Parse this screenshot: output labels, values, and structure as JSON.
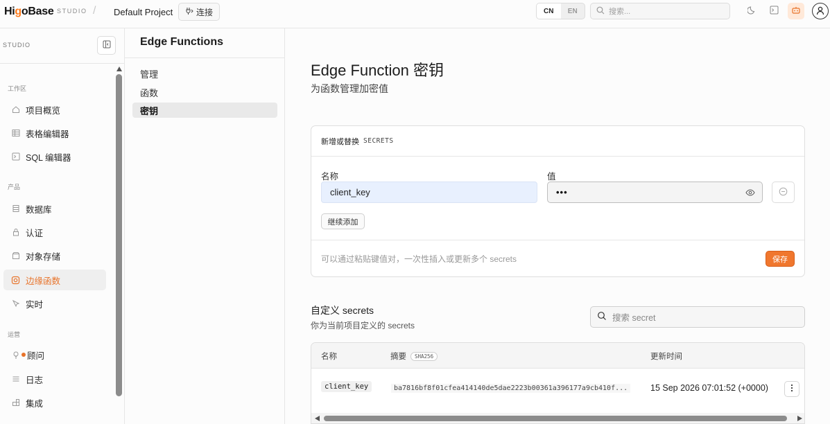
{
  "topbar": {
    "brand_prefix": "Hi",
    "brand_o": "g",
    "brand_suffix": "oBase",
    "studio_tag": "STUDIO",
    "separator": "/",
    "project_name": "Default Project",
    "connect_label": "连接",
    "lang_cn": "CN",
    "lang_en": "EN",
    "lang_active": "CN",
    "search_placeholder": "搜索...",
    "accent_color": "#f0772e"
  },
  "sidebar": {
    "header": "STUDIO",
    "sections": [
      {
        "label": "工作区"
      },
      {
        "label": "产品"
      },
      {
        "label": "运营"
      }
    ],
    "items": [
      {
        "label": "项目概览",
        "icon": "home-icon"
      },
      {
        "label": "表格编辑器",
        "icon": "table-icon"
      },
      {
        "label": "SQL 编辑器",
        "icon": "terminal-icon"
      },
      {
        "label": "数据库",
        "icon": "database-icon"
      },
      {
        "label": "认证",
        "icon": "lock-icon"
      },
      {
        "label": "对象存储",
        "icon": "archive-icon"
      },
      {
        "label": "边缘函数",
        "icon": "edge-function-icon",
        "active": true
      },
      {
        "label": "实时",
        "icon": "pointer-icon"
      },
      {
        "label": "顾问",
        "icon": "lightbulb-icon"
      },
      {
        "label": "日志",
        "icon": "list-icon"
      },
      {
        "label": "集成",
        "icon": "grid-icon"
      }
    ]
  },
  "subnav": {
    "title": "Edge Functions",
    "items": [
      {
        "label": "管理"
      },
      {
        "label": "函数"
      },
      {
        "label": "密钥",
        "active": true
      }
    ]
  },
  "main": {
    "title": "Edge Function 密钥",
    "subtitle": "为函数管理加密值",
    "card": {
      "header_label": "新增或替换",
      "header_mono": "SECRETS",
      "name_label": "名称",
      "value_label": "值",
      "name_value": "client_key",
      "value_masked": "•••",
      "add_more_label": "继续添加",
      "hint": "可以通过粘贴键值对，一次性插入或更新多个 secrets",
      "save_label": "保存"
    },
    "custom": {
      "title": "自定义 secrets",
      "subtitle": "你为当前项目定义的 secrets",
      "search_placeholder": "搜索 secret"
    },
    "table": {
      "columns": [
        "名称",
        "摘要",
        "更新时间"
      ],
      "digest_badge": "SHA256",
      "rows": [
        {
          "name": "client_key",
          "digest": "ba7816bf8f01cfea414140de5dae2223b00361a396177a9cb410f...",
          "updated": "15 Sep 2026 07:01:52 (+0000)"
        }
      ]
    }
  }
}
